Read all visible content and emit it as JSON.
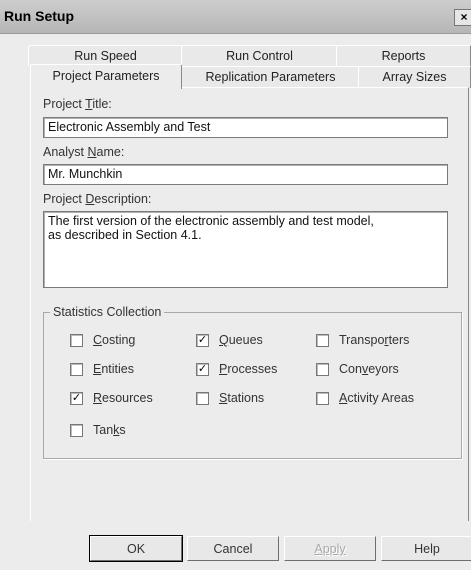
{
  "window": {
    "title": "Run Setup",
    "close_glyph": "×",
    "close_icon": "close-icon"
  },
  "tabs_back": [
    "Run Speed",
    "Run Control",
    "Reports"
  ],
  "tabs_front": [
    "Project Parameters",
    "Replication Parameters",
    "Array Sizes"
  ],
  "active_tab": "Project Parameters",
  "form": {
    "project_title": {
      "pre": "Project ",
      "u": "T",
      "post": "itle:",
      "value": "Electronic Assembly and Test"
    },
    "analyst_name": {
      "pre": "Analyst ",
      "u": "N",
      "post": "ame:",
      "value": "Mr. Munchkin"
    },
    "project_description": {
      "pre": "Project ",
      "u": "D",
      "post": "escription:",
      "line1": "The first version of the electronic assembly and test model,",
      "line2": "as described in Section 4.1."
    }
  },
  "statistics": {
    "group_label": "Statistics Collection",
    "items": [
      {
        "pre": "",
        "u": "C",
        "post": "osting",
        "checked": false
      },
      {
        "pre": "",
        "u": "Q",
        "post": "ueues",
        "checked": true
      },
      {
        "pre": "Transpo",
        "u": "r",
        "post": "ters",
        "checked": false
      },
      {
        "pre": "",
        "u": "E",
        "post": "ntities",
        "checked": false
      },
      {
        "pre": "",
        "u": "P",
        "post": "rocesses",
        "checked": true
      },
      {
        "pre": "Con",
        "u": "v",
        "post": "eyors",
        "checked": false
      },
      {
        "pre": "",
        "u": "R",
        "post": "esources",
        "checked": true
      },
      {
        "pre": "",
        "u": "S",
        "post": "tations",
        "checked": false
      },
      {
        "pre": "",
        "u": "A",
        "post": "ctivity Areas",
        "checked": false
      },
      {
        "pre": "Tan",
        "u": "k",
        "post": "s",
        "checked": false
      }
    ]
  },
  "buttons": {
    "ok": "OK",
    "cancel": "Cancel",
    "apply": "Apply",
    "help": "Help"
  }
}
